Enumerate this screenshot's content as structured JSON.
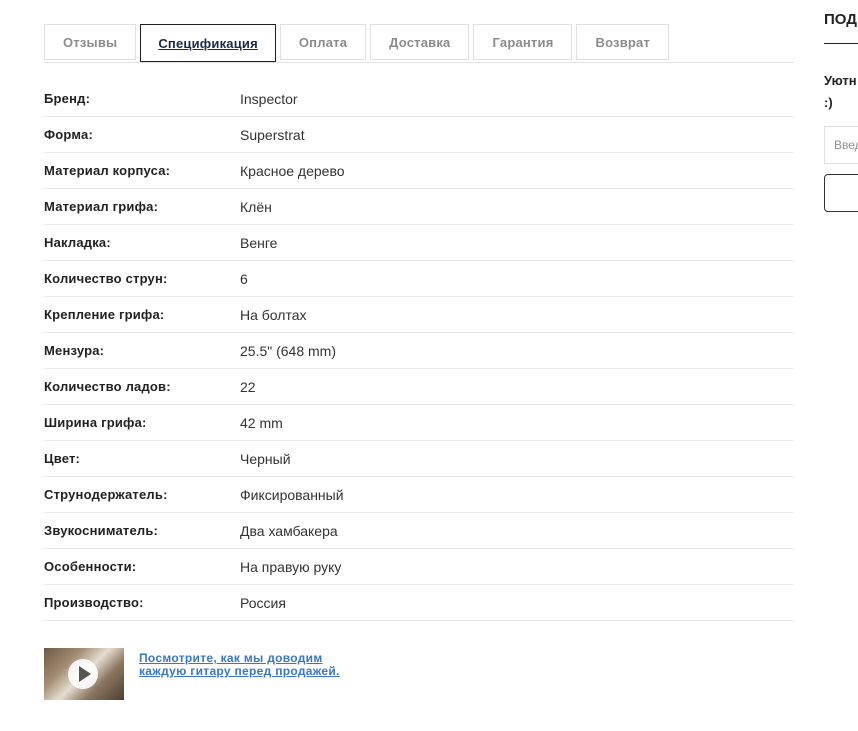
{
  "tabs": [
    {
      "label": "Отзывы",
      "active": false
    },
    {
      "label": "Спецификация",
      "active": true
    },
    {
      "label": "Оплата",
      "active": false
    },
    {
      "label": "Доставка",
      "active": false
    },
    {
      "label": "Гарантия",
      "active": false
    },
    {
      "label": "Возврат",
      "active": false
    }
  ],
  "specs": [
    {
      "label": "Бренд:",
      "value": "Inspector"
    },
    {
      "label": "Форма:",
      "value": "Superstrat"
    },
    {
      "label": "Материал корпуса:",
      "value": "Красное дерево"
    },
    {
      "label": "Материал грифа:",
      "value": "Клён"
    },
    {
      "label": "Накладка:",
      "value": "Венге"
    },
    {
      "label": "Количество струн:",
      "value": "6"
    },
    {
      "label": "Крепление грифа:",
      "value": "На болтах"
    },
    {
      "label": "Мензура:",
      "value": "25.5\" (648 mm)"
    },
    {
      "label": "Количество ладов:",
      "value": "22"
    },
    {
      "label": "Ширина грифа:",
      "value": "42 mm"
    },
    {
      "label": "Цвет:",
      "value": "Черный"
    },
    {
      "label": "Струнодержатель:",
      "value": "Фиксированный"
    },
    {
      "label": "Звукосниматель:",
      "value": "Два хамбакера"
    },
    {
      "label": "Особенности:",
      "value": "На правую руку"
    },
    {
      "label": "Производство:",
      "value": "Россия"
    }
  ],
  "video": {
    "link_text": "Посмотрите, как мы доводим каждую гитару перед продажей.",
    "thumbnail_icon": "play-icon"
  },
  "sidebar": {
    "title": "ПОД",
    "text_line1": "Уютн",
    "text_line2": ":)",
    "input_placeholder": "Введ"
  },
  "colors": {
    "link": "#3a78c2",
    "active_tab_text": "#1b2a44",
    "inactive_tab_text": "#8c8c8c"
  }
}
